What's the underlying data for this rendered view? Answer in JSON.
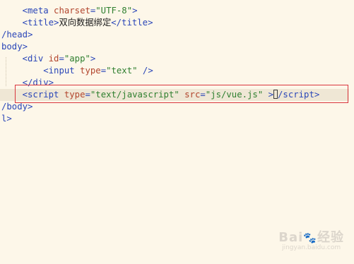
{
  "editor": {
    "lines": [
      {
        "indent": "    ",
        "parts": [
          [
            "tag",
            "<meta "
          ],
          [
            "attr",
            "charset"
          ],
          [
            "tag",
            "="
          ],
          [
            "str",
            "\"UTF-8\""
          ],
          [
            "tag",
            ">"
          ]
        ]
      },
      {
        "indent": "    ",
        "parts": [
          [
            "tag",
            "<title>"
          ],
          [
            "txt",
            "双向数据绑定"
          ],
          [
            "tag",
            "</title>"
          ]
        ]
      },
      {
        "indent": "",
        "parts": [
          [
            "tag",
            "/head>"
          ]
        ]
      },
      {
        "indent": "",
        "parts": [
          [
            "tag",
            "body>"
          ]
        ]
      },
      {
        "indent": "    ",
        "parts": [
          [
            "tag",
            "<div "
          ],
          [
            "attr",
            "id"
          ],
          [
            "tag",
            "="
          ],
          [
            "str",
            "\"app\""
          ],
          [
            "tag",
            ">"
          ]
        ]
      },
      {
        "indent": "        ",
        "parts": [
          [
            "tag",
            "<input "
          ],
          [
            "attr",
            "type"
          ],
          [
            "tag",
            "="
          ],
          [
            "str",
            "\"text\""
          ],
          [
            "tag",
            " />"
          ]
        ]
      },
      {
        "indent": "    ",
        "parts": [
          [
            "tag",
            "</div>"
          ]
        ]
      },
      {
        "indent": "    ",
        "current": true,
        "parts": [
          [
            "tag",
            "<script "
          ],
          [
            "attr",
            "type"
          ],
          [
            "tag",
            "="
          ],
          [
            "str",
            "\"text/javascript\""
          ],
          [
            "tag",
            " "
          ],
          [
            "attr",
            "src"
          ],
          [
            "tag",
            "="
          ],
          [
            "str",
            "\"js/vue.js\""
          ],
          [
            "tag",
            " >"
          ],
          [
            "cursor",
            ""
          ],
          [
            "tag",
            "/script>"
          ]
        ]
      },
      {
        "indent": "",
        "parts": [
          [
            "tag",
            "/body>"
          ]
        ]
      },
      {
        "indent": "",
        "parts": [
          [
            "tag",
            "l>"
          ]
        ]
      }
    ]
  },
  "watermark": {
    "logo": "Bai",
    "logo_icon": "paw-icon",
    "logo_suffix": "经验",
    "url": "jingyan.baidu.com"
  }
}
